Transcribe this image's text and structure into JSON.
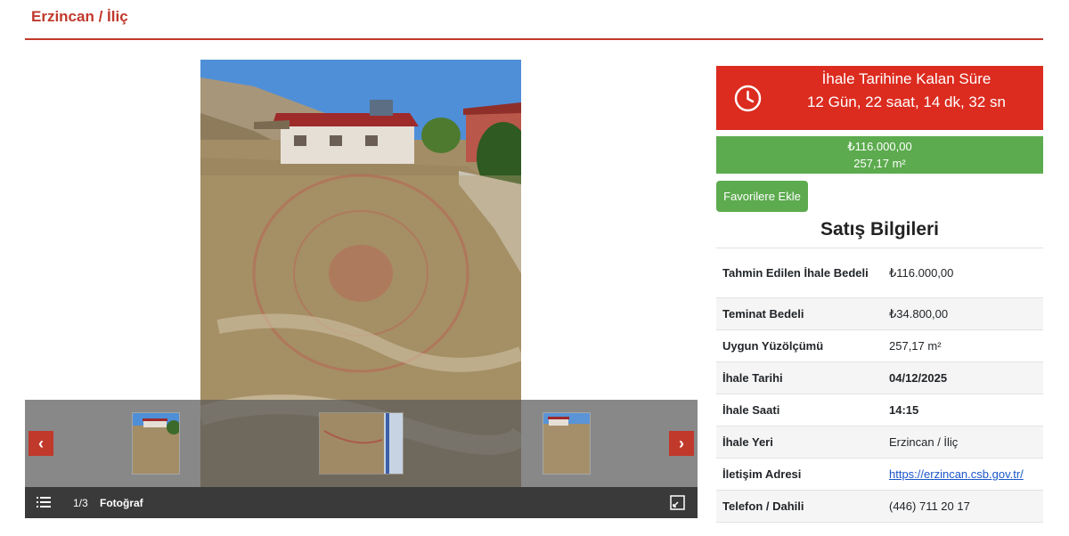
{
  "page": {
    "title": "Erzincan / İliç"
  },
  "gallery": {
    "counter": "1/3",
    "caption": "Fotoğraf",
    "prev_label": "‹",
    "next_label": "›",
    "thumbnails": [
      "photo-1",
      "photo-2",
      "photo-3"
    ]
  },
  "countdown": {
    "title": "İhale Tarihine Kalan Süre",
    "remaining": "12 Gün, 22 saat, 14 dk, 32 sn"
  },
  "price_box": {
    "price": "₺116.000,00",
    "area": "257,17 m²"
  },
  "favorite_button": "Favorilere Ekle",
  "sales_info": {
    "title": "Satış Bilgileri",
    "rows": [
      {
        "label": "Tahmin Edilen İhale Bedeli",
        "value": "₺116.000,00"
      },
      {
        "label": "Teminat Bedeli",
        "value": "₺34.800,00"
      },
      {
        "label": "Uygun Yüzölçümü",
        "value": "257,17 m²"
      },
      {
        "label": "İhale Tarihi",
        "value": "04/12/2025"
      },
      {
        "label": "İhale Saati",
        "value": "14:15"
      },
      {
        "label": "İhale Yeri",
        "value": "Erzincan / İliç"
      },
      {
        "label": "İletişim Adresi",
        "value": "https://erzincan.csb.gov.tr/"
      },
      {
        "label": "Telefon / Dahili",
        "value": "(446) 711 20 17"
      }
    ]
  },
  "colors": {
    "accent_red": "#dc2b1f",
    "title_red": "#c0392b",
    "price_green": "#5cab4e",
    "link_blue": "#1a56c8"
  }
}
